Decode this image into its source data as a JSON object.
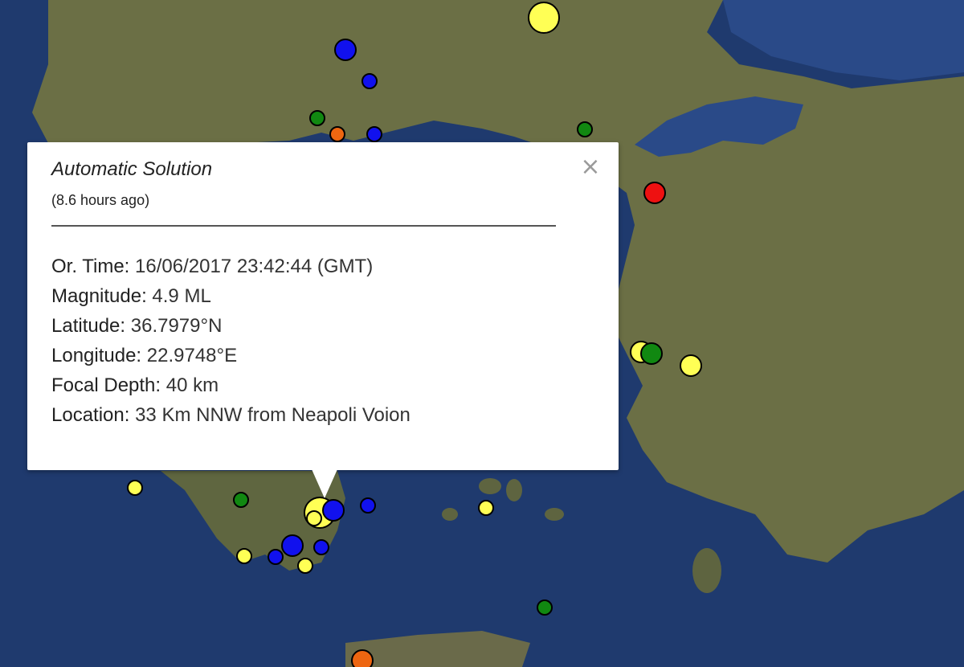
{
  "map": {
    "colors": {
      "sea": "#1f3a6e",
      "land": "#6b6f45",
      "marker_yellow": "#ffff55",
      "marker_blue": "#1111ee",
      "marker_green": "#118811",
      "marker_orange": "#ee6611",
      "marker_red": "#ee1111"
    },
    "markers": [
      {
        "color": "yellow",
        "mag": "large"
      },
      {
        "color": "blue",
        "mag": "medium"
      },
      {
        "color": "blue",
        "mag": "small"
      },
      {
        "color": "green",
        "mag": "small"
      },
      {
        "color": "orange",
        "mag": "small"
      },
      {
        "color": "blue",
        "mag": "small"
      },
      {
        "color": "green",
        "mag": "small"
      },
      {
        "color": "red",
        "mag": "medium"
      },
      {
        "color": "yellow",
        "mag": "medium"
      },
      {
        "color": "green",
        "mag": "medium"
      },
      {
        "color": "yellow",
        "mag": "medium"
      },
      {
        "color": "yellow",
        "mag": "small"
      },
      {
        "color": "green",
        "mag": "small"
      },
      {
        "color": "yellow",
        "mag": "large"
      },
      {
        "color": "yellow",
        "mag": "small"
      },
      {
        "color": "blue",
        "mag": "medium"
      },
      {
        "color": "blue",
        "mag": "small"
      },
      {
        "color": "blue",
        "mag": "medium"
      },
      {
        "color": "blue",
        "mag": "small"
      },
      {
        "color": "blue",
        "mag": "small"
      },
      {
        "color": "yellow",
        "mag": "small"
      },
      {
        "color": "yellow",
        "mag": "small"
      },
      {
        "color": "yellow",
        "mag": "small"
      },
      {
        "color": "green",
        "mag": "small"
      },
      {
        "color": "orange",
        "mag": "medium"
      }
    ]
  },
  "popup": {
    "title": "Automatic Solution",
    "subtitle": "(8.6 hours ago)",
    "close_icon": "×",
    "rows": [
      {
        "label": "Or. Time:",
        "value": " 16/06/2017  23:42:44 (GMT)"
      },
      {
        "label": "Magnitude:",
        "value": " 4.9 ML"
      },
      {
        "label": "Latitude:",
        "value": " 36.7979°N"
      },
      {
        "label": "Longitude:",
        "value": " 22.9748°E"
      },
      {
        "label": "Focal Depth:",
        "value": " 40 km"
      },
      {
        "label": "Location:",
        "value": " 33 Km NNW from Neapoli Voion"
      }
    ]
  }
}
